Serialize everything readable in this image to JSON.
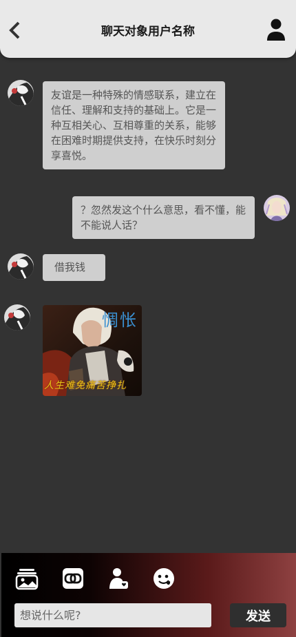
{
  "header": {
    "title": "聊天对象用户名称",
    "back_icon": "chevron-left-icon",
    "profile_icon": "user-icon"
  },
  "messages": [
    {
      "side": "left",
      "type": "text",
      "text": "友谊是一种特殊的情感联系，建立在信任、理解和支持的基础上。它是一种互相关心、互相尊重的关系，能够在困难时期提供支持，在快乐时刻分享喜悦。"
    },
    {
      "side": "right",
      "type": "text",
      "text": "？忽然发这个什么意思，看不懂，能不能说人话？"
    },
    {
      "side": "left",
      "type": "text",
      "text": "借我钱"
    },
    {
      "side": "left",
      "type": "image",
      "caption_top": "惆怅",
      "caption_bottom": "人生难免痛苦挣扎"
    }
  ],
  "footer": {
    "tools": [
      "photo-album-icon",
      "link-icon",
      "contact-card-icon",
      "emoji-icon"
    ],
    "input_placeholder": "想说什么呢?",
    "send_label": "发送"
  },
  "colors": {
    "background": "#333333",
    "header_bg": "#e9e9e9",
    "bubble_bg": "#cfcfcf",
    "footer_gradient_start": "#000000",
    "footer_gradient_end": "#8e4141"
  }
}
